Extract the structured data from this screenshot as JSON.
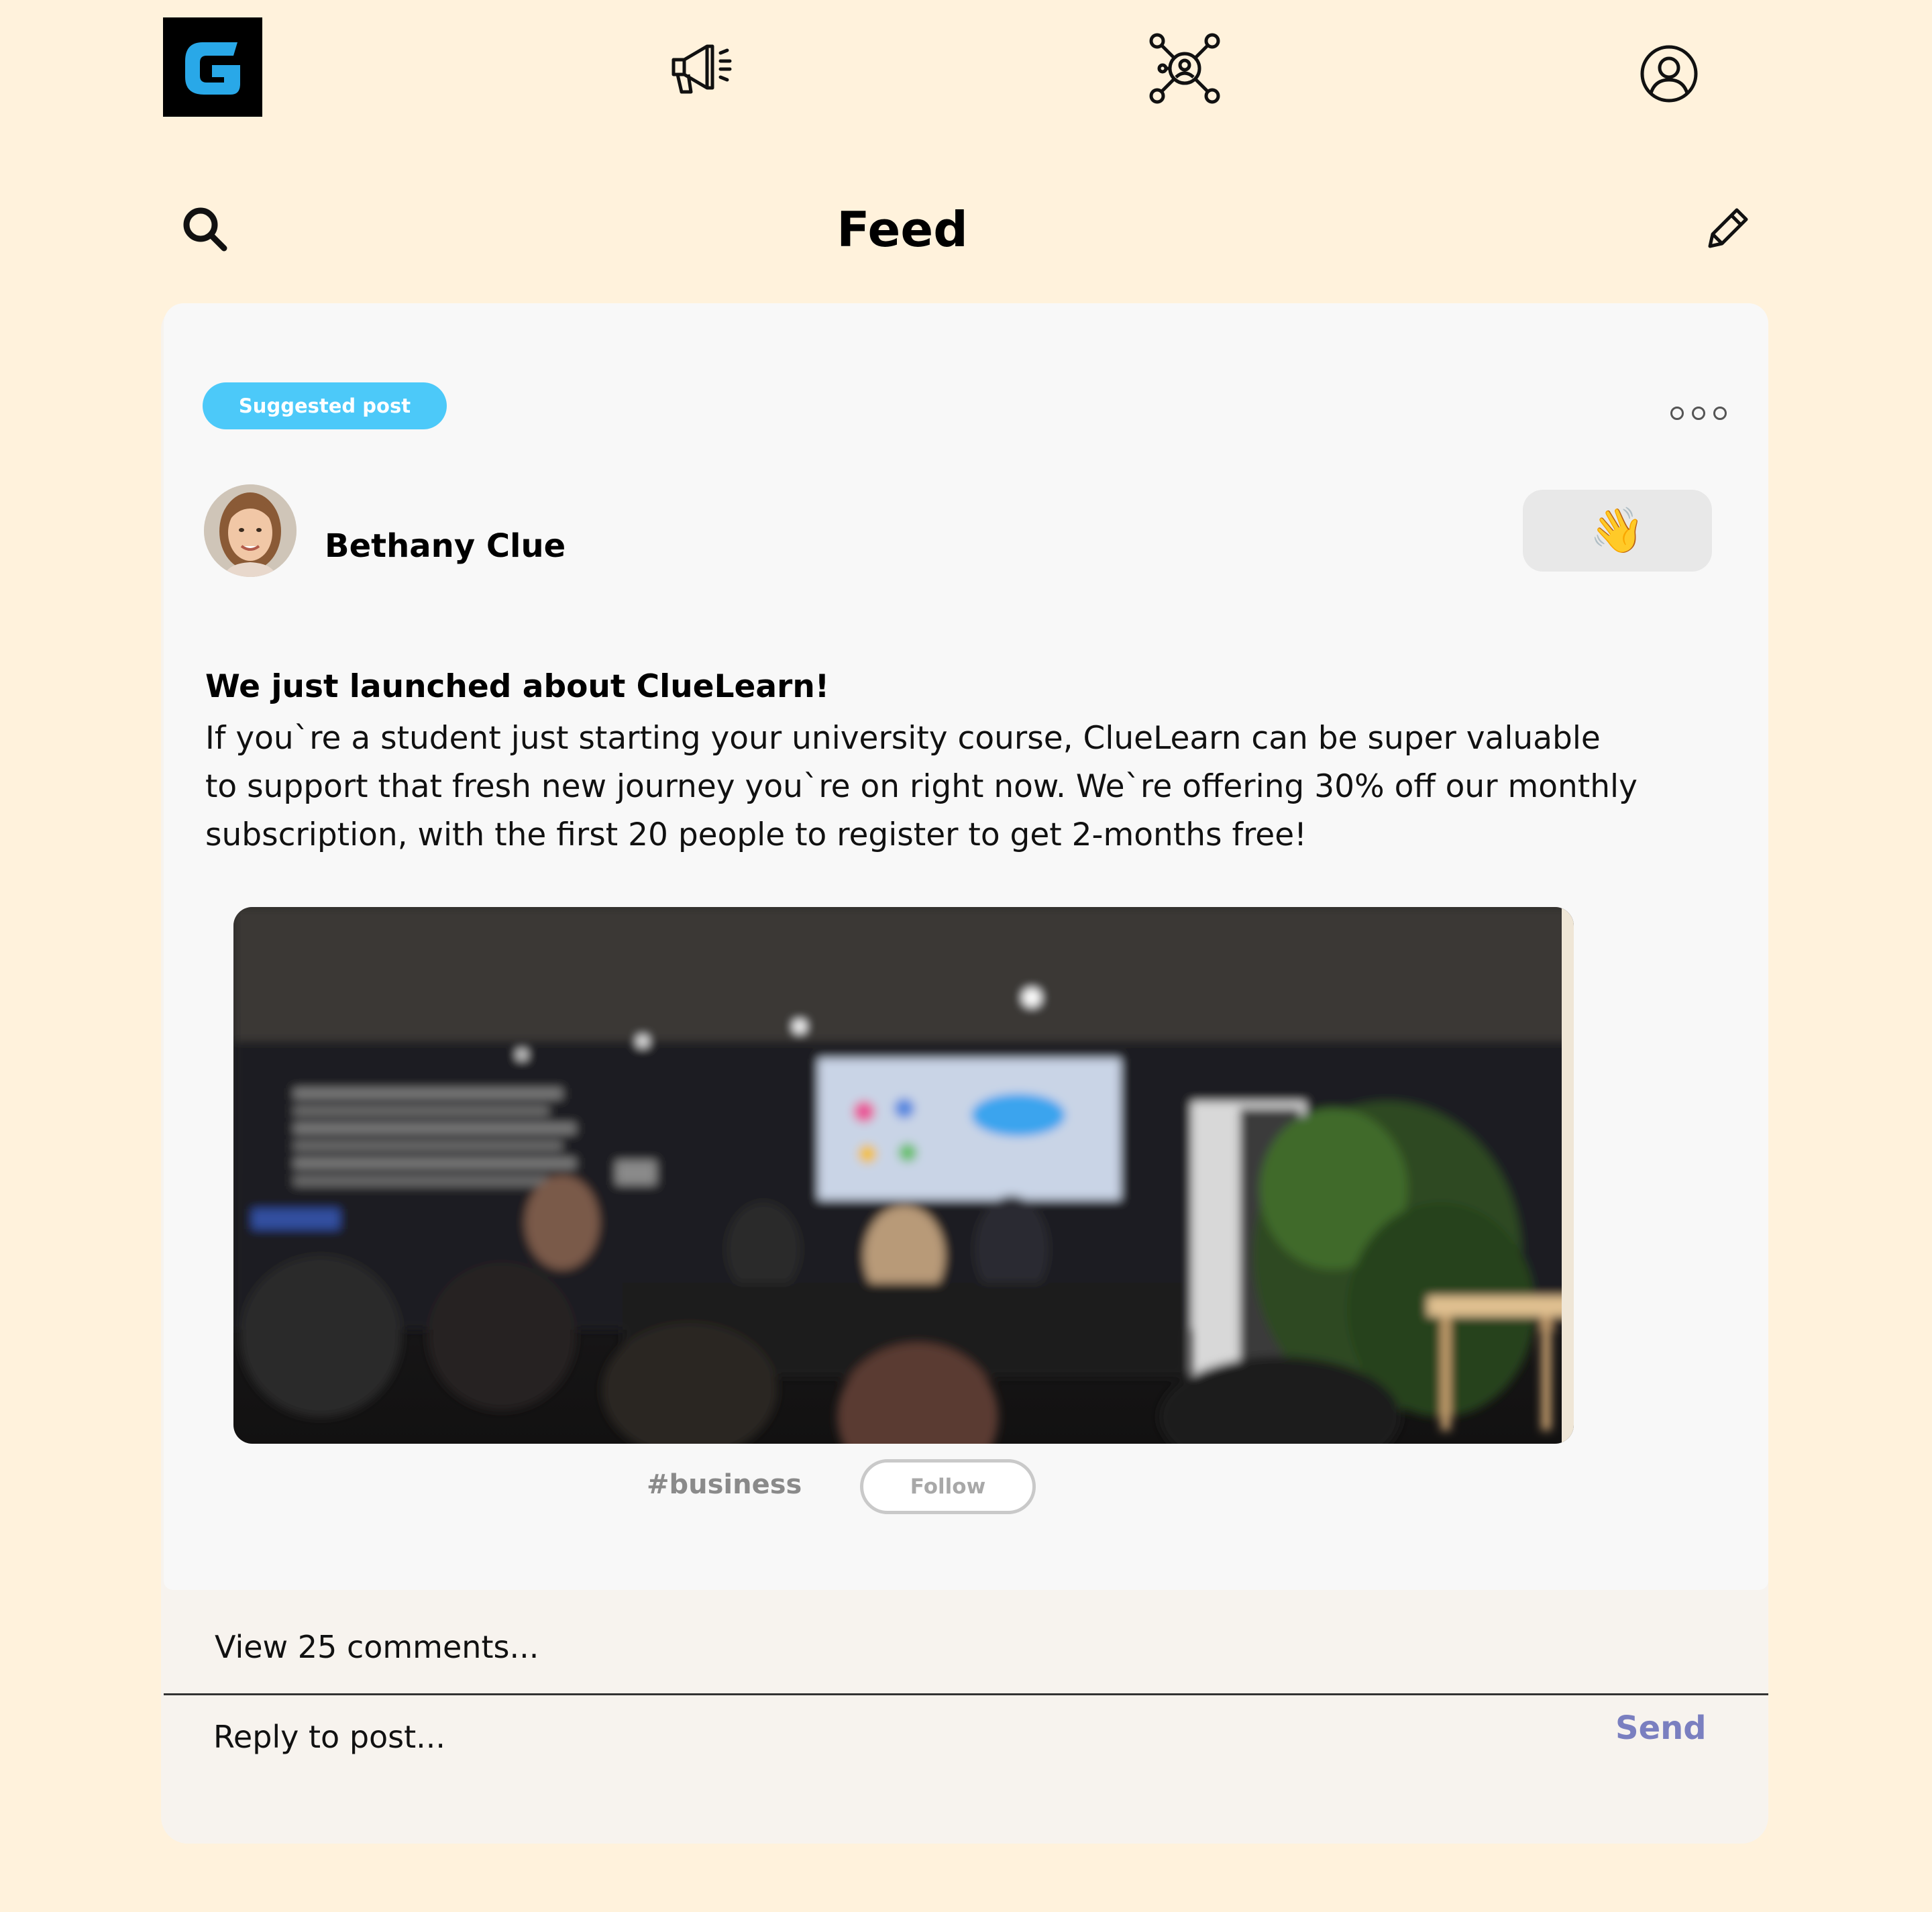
{
  "nav": {
    "logo_letter": "G",
    "icons": [
      "megaphone-icon",
      "network-icon",
      "profile-icon"
    ]
  },
  "header": {
    "title": "Feed",
    "icons": [
      "search-icon",
      "edit-icon"
    ]
  },
  "post": {
    "badge": "Suggested post",
    "author": "Bethany Clue",
    "reaction_emoji": "👋",
    "headline": "We just launched about ClueLearn!",
    "body_lines": [
      "If you`re a student just starting your university course, ClueLearn can be super valuable",
      "to support that fresh new journey you`re on right now. We`re offering 30% off our monthly",
      "subscription, with the first 20 people to register to get 2-months free!"
    ],
    "hashtag": "#business",
    "follow_label": "Follow"
  },
  "comments": {
    "view_label": "View 25 comments...",
    "reply_placeholder": "Reply to post...",
    "send_label": "Send"
  },
  "colors": {
    "background": "#FFF2DC",
    "badge": "#4CC9F9",
    "logo_accent": "#29A8E8",
    "send": "#7A7FC0"
  }
}
